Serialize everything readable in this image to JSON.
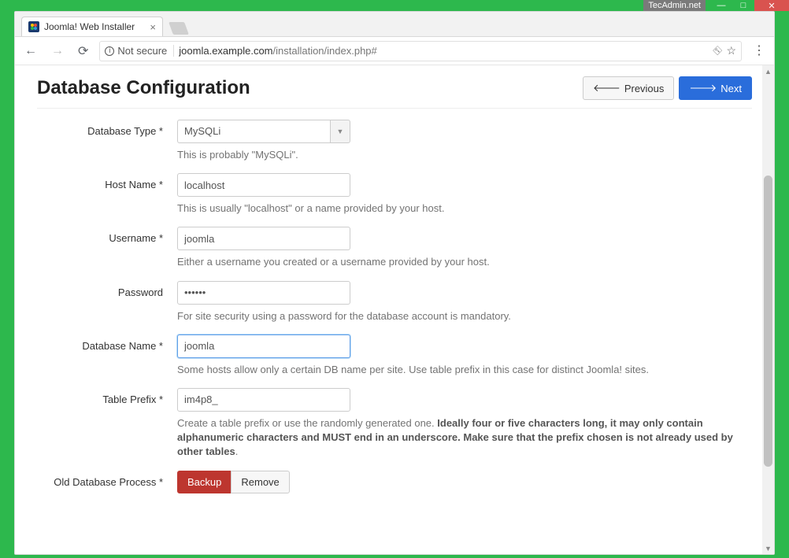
{
  "window": {
    "watermark": "TecAdmin.net"
  },
  "browser": {
    "tab_title": "Joomla! Web Installer",
    "insecure_label": "Not secure",
    "url_host": "joomla.example.com",
    "url_path": "/installation/index.php#"
  },
  "page": {
    "title": "Database Configuration",
    "prev_label": "Previous",
    "next_label": "Next"
  },
  "form": {
    "db_type": {
      "label": "Database Type *",
      "value": "MySQLi",
      "help": "This is probably \"MySQLi\"."
    },
    "host": {
      "label": "Host Name *",
      "value": "localhost",
      "help": "This is usually \"localhost\" or a name provided by your host."
    },
    "user": {
      "label": "Username *",
      "value": "joomla",
      "help": "Either a username you created or a username provided by your host."
    },
    "pass": {
      "label": "Password",
      "value": "••••••",
      "help": "For site security using a password for the database account is mandatory."
    },
    "db_name": {
      "label": "Database Name *",
      "value": "joomla",
      "help": "Some hosts allow only a certain DB name per site. Use table prefix in this case for distinct Joomla! sites."
    },
    "prefix": {
      "label": "Table Prefix *",
      "value": "im4p8_",
      "help_pre": "Create a table prefix or use the randomly generated one. ",
      "help_strong": "Ideally four or five characters long, it may only contain alphanumeric characters and MUST end in an underscore. Make sure that the prefix chosen is not already used by other tables",
      "help_post": "."
    },
    "old_db": {
      "label": "Old Database Process *",
      "backup": "Backup",
      "remove": "Remove"
    }
  }
}
